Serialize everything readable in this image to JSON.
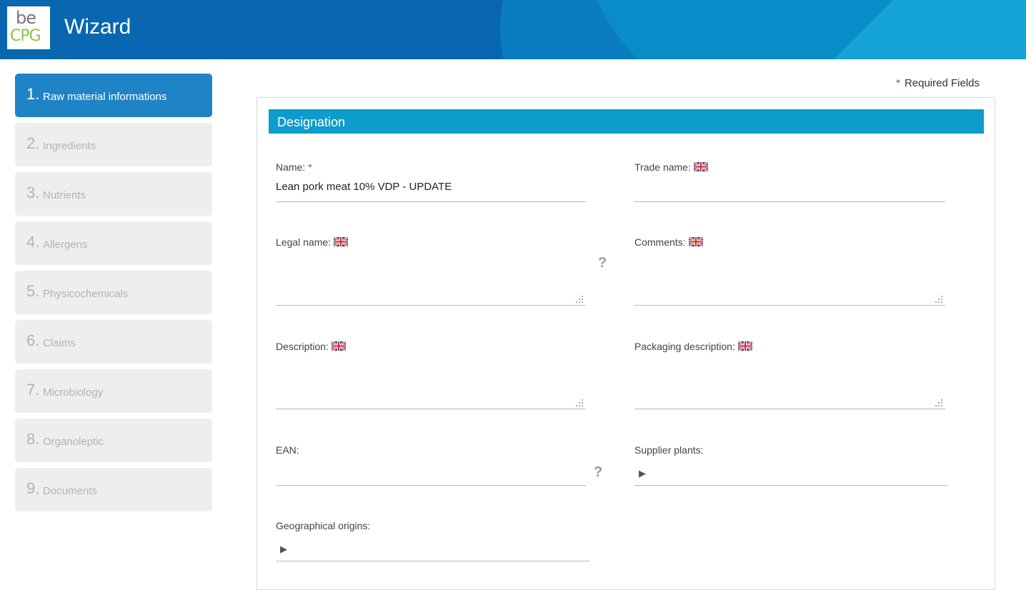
{
  "header": {
    "logo_top": "be",
    "logo_bottom": "CPG",
    "title": "Wizard"
  },
  "steps": [
    {
      "num": "1.",
      "label": "Raw material informations",
      "active": true
    },
    {
      "num": "2.",
      "label": "Ingredients",
      "active": false
    },
    {
      "num": "3.",
      "label": "Nutrients",
      "active": false
    },
    {
      "num": "4.",
      "label": "Allergens",
      "active": false
    },
    {
      "num": "5.",
      "label": "Physicochemicals",
      "active": false
    },
    {
      "num": "6.",
      "label": "Claims",
      "active": false
    },
    {
      "num": "7.",
      "label": "Microbiology",
      "active": false
    },
    {
      "num": "8.",
      "label": "Organoleptic",
      "active": false
    },
    {
      "num": "9.",
      "label": "Documents",
      "active": false
    }
  ],
  "required_note": {
    "star": "*",
    "text": "Required Fields"
  },
  "section": {
    "title": "Designation"
  },
  "fields": {
    "name": {
      "label": "Name:",
      "star": "*",
      "value": "Lean pork meat 10% VDP - UPDATE"
    },
    "trade_name": {
      "label": "Trade name:",
      "value": ""
    },
    "legal_name": {
      "label": "Legal name:",
      "value": ""
    },
    "comments": {
      "label": "Comments:",
      "value": ""
    },
    "description": {
      "label": "Description:",
      "value": ""
    },
    "packaging_description": {
      "label": "Packaging description:",
      "value": ""
    },
    "ean": {
      "label": "EAN:",
      "value": ""
    },
    "supplier_plants": {
      "label": "Supplier plants:",
      "value": ""
    },
    "geographical_origins": {
      "label": "Geographical origins:",
      "value": ""
    }
  },
  "help_glyph": "?",
  "expand_glyph": "▶",
  "icons": {
    "flag": "uk-flag-icon",
    "resize": "resize-handle-icon",
    "help": "help-icon",
    "expand": "expand-arrow-icon"
  },
  "colors": {
    "header_bg": "#0867b0",
    "active_step": "#1f84c6",
    "section_bar": "#0d9ccb",
    "required_star": "#2e8b30",
    "inactive_step": "#eeeeee"
  }
}
